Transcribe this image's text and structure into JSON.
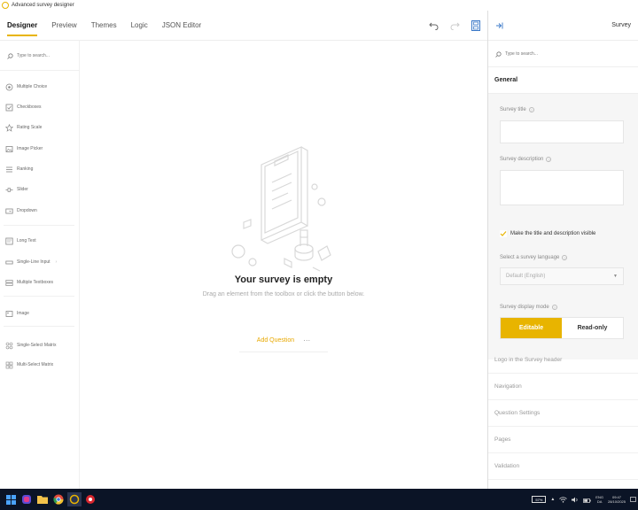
{
  "window": {
    "title": "Advanced survey designer"
  },
  "nav": {
    "tabs": [
      {
        "label": "Designer",
        "active": true
      },
      {
        "label": "Preview",
        "active": false
      },
      {
        "label": "Themes",
        "active": false
      },
      {
        "label": "Logic",
        "active": false
      },
      {
        "label": "JSON Editor",
        "active": false
      }
    ]
  },
  "toolbox": {
    "search_placeholder": "Type to search...",
    "items": [
      {
        "label": "Multiple Choice",
        "icon": "radio-icon"
      },
      {
        "label": "Checkboxes",
        "icon": "checkbox-icon"
      },
      {
        "label": "Rating Scale",
        "icon": "star-icon"
      },
      {
        "label": "Image Picker",
        "icon": "image-picker-icon"
      },
      {
        "label": "Ranking",
        "icon": "ranking-icon"
      },
      {
        "label": "Slider",
        "icon": "slider-icon"
      },
      {
        "label": "Dropdown",
        "icon": "dropdown-icon"
      },
      {
        "label": "Long Text",
        "icon": "long-text-icon"
      },
      {
        "label": "Single-Line Input",
        "icon": "single-line-icon"
      },
      {
        "label": "Multiple Textboxes",
        "icon": "multiple-textboxes-icon"
      },
      {
        "label": "Image",
        "icon": "image-icon"
      },
      {
        "label": "Single-Select Matrix",
        "icon": "single-matrix-icon"
      },
      {
        "label": "Multi-Select Matrix",
        "icon": "multi-matrix-icon"
      }
    ]
  },
  "canvas": {
    "empty_title": "Your survey is empty",
    "empty_subtitle": "Drag an element from the toolbox or click the button below.",
    "add_question": "Add Question",
    "more": "···"
  },
  "panel": {
    "title": "Survey",
    "search_placeholder": "Type to search...",
    "general": {
      "heading": "General",
      "survey_title_label": "Survey title",
      "survey_description_label": "Survey description",
      "visible_checkbox_label": "Make the title and description visible",
      "visible_checked": true,
      "language_label": "Select a survey language",
      "language_value": "Default (English)",
      "display_mode_label": "Survey display mode",
      "mode_editable": "Editable",
      "mode_readonly": "Read-only"
    },
    "sections": [
      "Logo in the Survey header",
      "Navigation",
      "Question Settings",
      "Pages",
      "Validation"
    ]
  },
  "taskbar": {
    "battery": "57%",
    "lang_top": "ENG",
    "lang_bottom": "DA",
    "time": "09:47",
    "date": "28/10/2025"
  },
  "colors": {
    "accent": "#e8b400",
    "taskbar": "#0b1426"
  }
}
